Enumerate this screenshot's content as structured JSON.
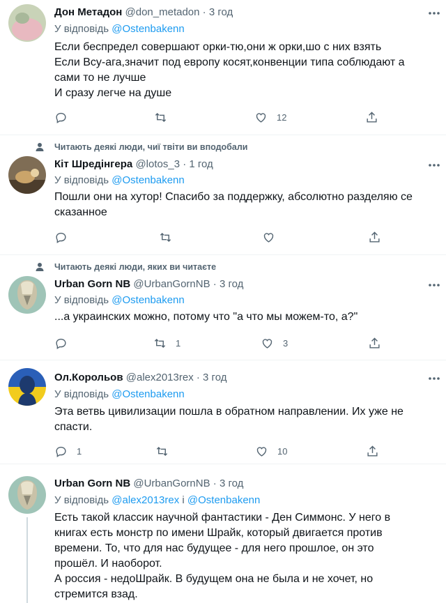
{
  "tweets": [
    {
      "social": "",
      "name": "Дон Метадон",
      "handle": "@don_metadon",
      "time": "3 год",
      "reply_prefix": "У відповідь ",
      "reply_to": "@Ostenbakenn",
      "reply_join": "",
      "reply_to2": "",
      "lines": [
        "Если беспредел совершают орки-тю,они ж орки,шо с них взять",
        "Если Всу-ага,значит под европу косят,конвенции типа соблюдают а",
        "сами то не лучше",
        "И сразу легче на душе"
      ],
      "replies": "",
      "retweets": "",
      "likes": "12"
    },
    {
      "social": "Читають деякі люди, чиї твіти ви вподобали",
      "name": "Кіт Шредінгера",
      "handle": "@lotos_3",
      "time": "1 год",
      "reply_prefix": "У відповідь ",
      "reply_to": "@Ostenbakenn",
      "reply_join": "",
      "reply_to2": "",
      "lines": [
        "Пошли они на хутор! Спасибо за поддержку, абсолютно разделяю се",
        "сказанное"
      ],
      "replies": "",
      "retweets": "",
      "likes": ""
    },
    {
      "social": "Читають деякі люди, яких ви читаєте",
      "name": "Urban Gorn NB",
      "handle": "@UrbanGornNB",
      "time": "3 год",
      "reply_prefix": "У відповідь ",
      "reply_to": "@Ostenbakenn",
      "reply_join": "",
      "reply_to2": "",
      "lines": [
        "...а украинских можно, потому что \"а что мы можем-то, а?\""
      ],
      "replies": "",
      "retweets": "1",
      "likes": "3"
    },
    {
      "social": "",
      "name": "Ол.Корольов",
      "handle": "@alex2013rex",
      "time": "3 год",
      "reply_prefix": "У відповідь ",
      "reply_to": "@Ostenbakenn",
      "reply_join": "",
      "reply_to2": "",
      "lines": [
        "Эта ветвь цивилизации пошла в обратном направлении. Их уже не",
        "спасти."
      ],
      "replies": "1",
      "retweets": "",
      "likes": "10"
    },
    {
      "social": "",
      "name": "Urban Gorn NB",
      "handle": "@UrbanGornNB",
      "time": "3 год",
      "reply_prefix": "У відповідь ",
      "reply_to": "@alex2013rex",
      "reply_join": " і ",
      "reply_to2": "@Ostenbakenn",
      "lines": [
        "Есть такой классик научной фантастики - Ден Симмонс. У него в",
        "книгах есть монстр по имени Шрайк, который двигается против",
        "времени. То, что для нас будущее - для него прошлое, он это",
        "прошёл. И наоборот.",
        "А россия - недоШрайк. В будущем она не была и не хочет, но",
        "стремится взад."
      ],
      "replies": "",
      "retweets": "",
      "likes": ""
    }
  ],
  "dot": "·",
  "colors": {
    "link": "#1d9bf0",
    "muted": "#536471",
    "text": "#0f1419"
  }
}
